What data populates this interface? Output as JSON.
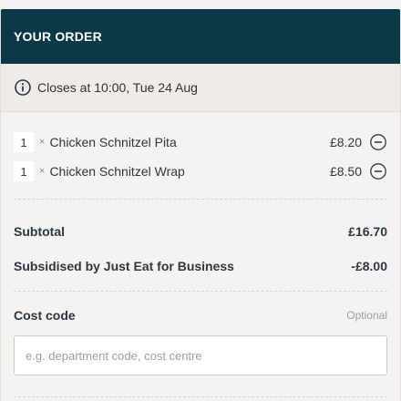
{
  "header": {
    "title": "YOUR ORDER"
  },
  "closing": {
    "text": "Closes at 10:00, Tue 24 Aug",
    "icon": "info-icon"
  },
  "items": [
    {
      "qty": "1",
      "times": "×",
      "name": "Chicken Schnitzel Pita",
      "price": "£8.20",
      "icon": "remove-icon"
    },
    {
      "qty": "1",
      "times": "×",
      "name": "Chicken Schnitzel Wrap",
      "price": "£8.50",
      "icon": "remove-icon"
    }
  ],
  "totals": {
    "subtotal_label": "Subtotal",
    "subtotal_value": "£16.70",
    "subsidy_label": "Subsidised by Just Eat for Business",
    "subsidy_value": "-£8.00"
  },
  "cost_code": {
    "label": "Cost code",
    "optional": "Optional",
    "placeholder": "e.g. department code, cost centre",
    "value": ""
  },
  "colors": {
    "header_bg": "#0a3847",
    "panel_bg": "#f5f3f1",
    "text": "#2a3846"
  }
}
